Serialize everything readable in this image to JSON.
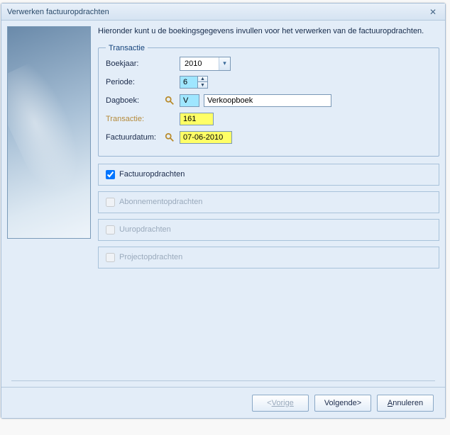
{
  "title": "Verwerken factuuropdrachten",
  "intro": "Hieronder kunt u de boekingsgegevens invullen voor het verwerken van de factuuropdrachten.",
  "transactie": {
    "legend": "Transactie",
    "boekjaar_label": "Boekjaar:",
    "boekjaar_value": "2010",
    "periode_label": "Periode:",
    "periode_value": "6",
    "dagboek_label": "Dagboek:",
    "dagboek_code": "V",
    "dagboek_name": "Verkoopboek",
    "transactie_label": "Transactie:",
    "transactie_value": "161",
    "factuurdatum_label": "Factuurdatum:",
    "factuurdatum_value": "07-06-2010"
  },
  "checks": {
    "factuuropdrachten": {
      "label": "Factuuropdrachten",
      "checked": true,
      "enabled": true
    },
    "abonnement": {
      "label": "Abonnementopdrachten",
      "checked": false,
      "enabled": false
    },
    "uur": {
      "label": "Uuropdrachten",
      "checked": false,
      "enabled": false
    },
    "project": {
      "label": "Projectopdrachten",
      "checked": false,
      "enabled": false
    }
  },
  "buttons": {
    "prev": "Vorige",
    "next": "Volgende",
    "cancel": "Annuleren"
  }
}
